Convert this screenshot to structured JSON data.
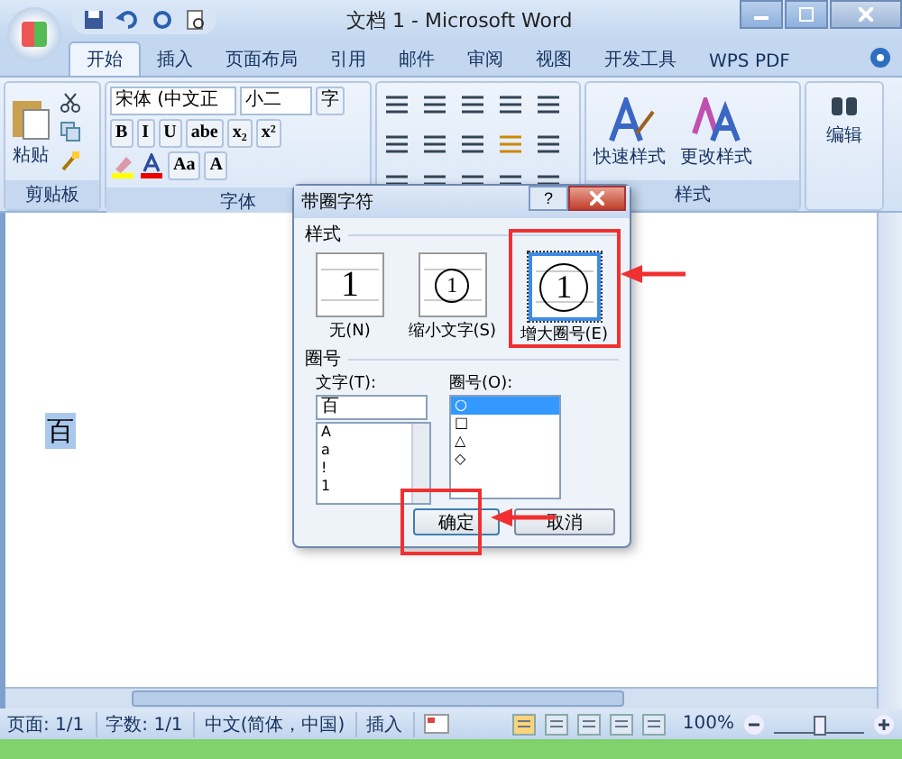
{
  "window": {
    "title": "文档 1 - Microsoft Word"
  },
  "tabs": [
    {
      "label": "开始",
      "selected": true
    },
    {
      "label": "插入",
      "selected": false
    },
    {
      "label": "页面布局",
      "selected": false
    },
    {
      "label": "引用",
      "selected": false
    },
    {
      "label": "邮件",
      "selected": false
    },
    {
      "label": "审阅",
      "selected": false
    },
    {
      "label": "视图",
      "selected": false
    },
    {
      "label": "开发工具",
      "selected": false
    },
    {
      "label": "WPS PDF",
      "selected": false
    }
  ],
  "ribbon": {
    "clipboard": {
      "paste": "粘贴",
      "label": "剪贴板"
    },
    "font": {
      "font_name": "宋体 (中文正",
      "font_size": "小二",
      "format_buttons": [
        "B",
        "I",
        "U",
        "abe",
        "x₂",
        "x²"
      ],
      "case_button": "Aa",
      "shade_button": "A",
      "enclose_button": "字",
      "label": "字体"
    },
    "styles": {
      "quick": "快速样式",
      "change": "更改样式",
      "label": "样式"
    },
    "editing": {
      "label": "编辑"
    }
  },
  "document": {
    "text": "百"
  },
  "dialog": {
    "title": "带圈字符",
    "help": "?",
    "style_label": "样式",
    "styles": [
      {
        "label": "无(N)",
        "kind": "plain",
        "sample": "1",
        "selected": false
      },
      {
        "label": "缩小文字(S)",
        "kind": "shrink",
        "sample": "1",
        "selected": false
      },
      {
        "label": "增大圈号(E)",
        "kind": "enlarge",
        "sample": "1",
        "selected": true
      }
    ],
    "enclosure_label": "圈号",
    "text_label": "文字(T):",
    "text_value": "百",
    "text_options": [
      "A",
      "a",
      "!",
      "1"
    ],
    "circle_label": "圈号(O):",
    "circle_options": [
      {
        "symbol": "○",
        "selected": true
      },
      {
        "symbol": "□",
        "selected": false
      },
      {
        "symbol": "△",
        "selected": false
      },
      {
        "symbol": "◇",
        "selected": false
      }
    ],
    "buttons": [
      "确定",
      "取消"
    ]
  },
  "status_bar": {
    "page": "页面: 1/1",
    "words": "字数: 1/1",
    "language": "中文(简体，中国)",
    "mode": "插入",
    "zoom": "100%",
    "zoom_slider": {
      "level": 0.5
    }
  }
}
